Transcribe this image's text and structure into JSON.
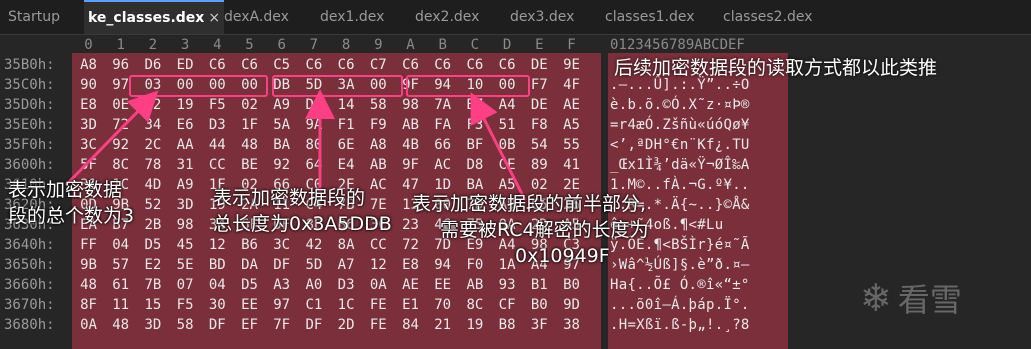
{
  "tabs": [
    {
      "label": "Startup",
      "active": false
    },
    {
      "label": "ke_classes.dex",
      "active": true,
      "close": "×"
    },
    {
      "label": "dexA.dex",
      "active": false
    },
    {
      "label": "dex1.dex",
      "active": false
    },
    {
      "label": "dex2.dex",
      "active": false
    },
    {
      "label": "dex3.dex",
      "active": false
    },
    {
      "label": "classes1.dex",
      "active": false
    },
    {
      "label": "classes2.dex",
      "active": false
    }
  ],
  "columns": [
    "0",
    "1",
    "2",
    "3",
    "4",
    "5",
    "6",
    "7",
    "8",
    "9",
    "A",
    "B",
    "C",
    "D",
    "E",
    "F"
  ],
  "ascii_header": "0123456789ABCDEF",
  "rows": [
    {
      "addr": "35B0h:",
      "bytes": [
        "A8",
        "96",
        "D6",
        "ED",
        "C6",
        "C6",
        "C5",
        "C6",
        "C6",
        "C7",
        "C6",
        "C6",
        "C6",
        "C6",
        "DE",
        "9E"
      ],
      "ascii": ""
    },
    {
      "addr": "35C0h:",
      "bytes": [
        "90",
        "97",
        "03",
        "00",
        "00",
        "00",
        "DB",
        "5D",
        "3A",
        "00",
        "9F",
        "94",
        "10",
        "00",
        "F7",
        "4F"
      ],
      "ascii": ".—...Û].:.Ÿ”..÷O"
    },
    {
      "addr": "35D0h:",
      "bytes": [
        "E8",
        "0E",
        "62",
        "19",
        "F5",
        "02",
        "A9",
        "D3",
        "14",
        "58",
        "98",
        "7A",
        "B7",
        "A4",
        "DE",
        "AE"
      ],
      "ascii": "è.b.õ.©Ó.X˜z·¤Þ®"
    },
    {
      "addr": "35E0h:",
      "bytes": [
        "3D",
        "72",
        "34",
        "E6",
        "D3",
        "1F",
        "5A",
        "9A",
        "F1",
        "F9",
        "AB",
        "FA",
        "F3",
        "51",
        "F8",
        "A5"
      ],
      "ascii": "=r4æÓ.Zšñù«úóQø¥"
    },
    {
      "addr": "35F0h:",
      "bytes": [
        "3C",
        "92",
        "2C",
        "AA",
        "44",
        "48",
        "BA",
        "80",
        "6E",
        "A8",
        "4B",
        "66",
        "BF",
        "0B",
        "54",
        "55"
      ],
      "ascii": "<’,ªDH°€n¨Kf¿.TU"
    },
    {
      "addr": "3600h:",
      "bytes": [
        "5F",
        "8C",
        "78",
        "31",
        "CC",
        "BE",
        "92",
        "64",
        "E4",
        "AB",
        "9F",
        "AC",
        "D8",
        "CE",
        "89",
        "41"
      ],
      "ascii": "_Œx1Ì¾’dä«Ÿ¬ØÎ‰A"
    },
    {
      "addr": "3610h:",
      "bytes": [
        "31",
        "1C",
        "4D",
        "A9",
        "1F",
        "02",
        "66",
        "C0",
        "2E",
        "AC",
        "47",
        "1D",
        "BA",
        "A5",
        "02",
        "2E"
      ],
      "ascii": "1.M©..fÀ.¬G.º¥.."
    },
    {
      "addr": "3620h:",
      "bytes": [
        "0D",
        "9B",
        "52",
        "3D",
        "19",
        "2A",
        "11",
        "C4",
        "7B",
        "7E",
        "13",
        "00",
        "7D",
        "A9",
        "C5",
        "26"
      ],
      "ascii": "..R=.*.Ä{~..}©Å&"
    },
    {
      "addr": "3630h:",
      "bytes": [
        "EA",
        "B7",
        "2B",
        "98",
        "34",
        "6F",
        "DF",
        "8E",
        "B6",
        "3C",
        "23",
        "4C",
        "75",
        "0A",
        "2D",
        "A5"
      ],
      "ascii": "ê·+˜4oß.¶<#Lu"
    },
    {
      "addr": "3640h:",
      "bytes": [
        "FF",
        "04",
        "D5",
        "45",
        "12",
        "B6",
        "3C",
        "42",
        "8A",
        "CC",
        "72",
        "7D",
        "E9",
        "A4",
        "98",
        "C3"
      ],
      "ascii": "ÿ.ÕE.¶<BŠÌr}é¤˜Ã"
    },
    {
      "addr": "3650h:",
      "bytes": [
        "9B",
        "57",
        "E2",
        "5E",
        "BD",
        "DA",
        "DF",
        "5D",
        "A7",
        "12",
        "E8",
        "94",
        "F0",
        "1A",
        "A4",
        "97"
      ],
      "ascii": "›Wâ^½Úß]§.è”ð.¤—"
    },
    {
      "addr": "3660h:",
      "bytes": [
        "48",
        "61",
        "7B",
        "07",
        "04",
        "D5",
        "A3",
        "A0",
        "D3",
        "0A",
        "AE",
        "EE",
        "AB",
        "93",
        "B1",
        "B0"
      ],
      "ascii": "Ha{..Õ£ Ó.®î«“±°"
    },
    {
      "addr": "3670h:",
      "bytes": [
        "8F",
        "11",
        "15",
        "F5",
        "30",
        "EE",
        "97",
        "C1",
        "1C",
        "FE",
        "E1",
        "70",
        "8C",
        "CF",
        "B0",
        "9D"
      ],
      "ascii": "...õ0î—Á.þáp.Ï°."
    },
    {
      "addr": "3680h:",
      "bytes": [
        "0A",
        "48",
        "3D",
        "58",
        "DF",
        "EF",
        "7F",
        "DF",
        "2D",
        "FE",
        "84",
        "21",
        "19",
        "B8",
        "3F",
        "38"
      ],
      "ascii": ".H=Xßï.ß-þ„!.¸?8"
    }
  ],
  "annotations": {
    "title": "后续加密数据段的读取方式都以此类推",
    "count": "表示加密数据\n段的总个数为3",
    "total_length": "表示加密数据段的\n总长度为0x3A5DDB",
    "first_half": "表示加密数据段的前半部分,",
    "rc4": "需要被RC4解密的长度为",
    "rc4_value": "0x10949F"
  },
  "watermark": {
    "icon": "snowflake-icon",
    "text": "看雪"
  },
  "colors": {
    "highlight_bg": "#7a2f3a",
    "box": "#ff3f84",
    "note": "#ffffff",
    "note_red": "#ff5050"
  }
}
